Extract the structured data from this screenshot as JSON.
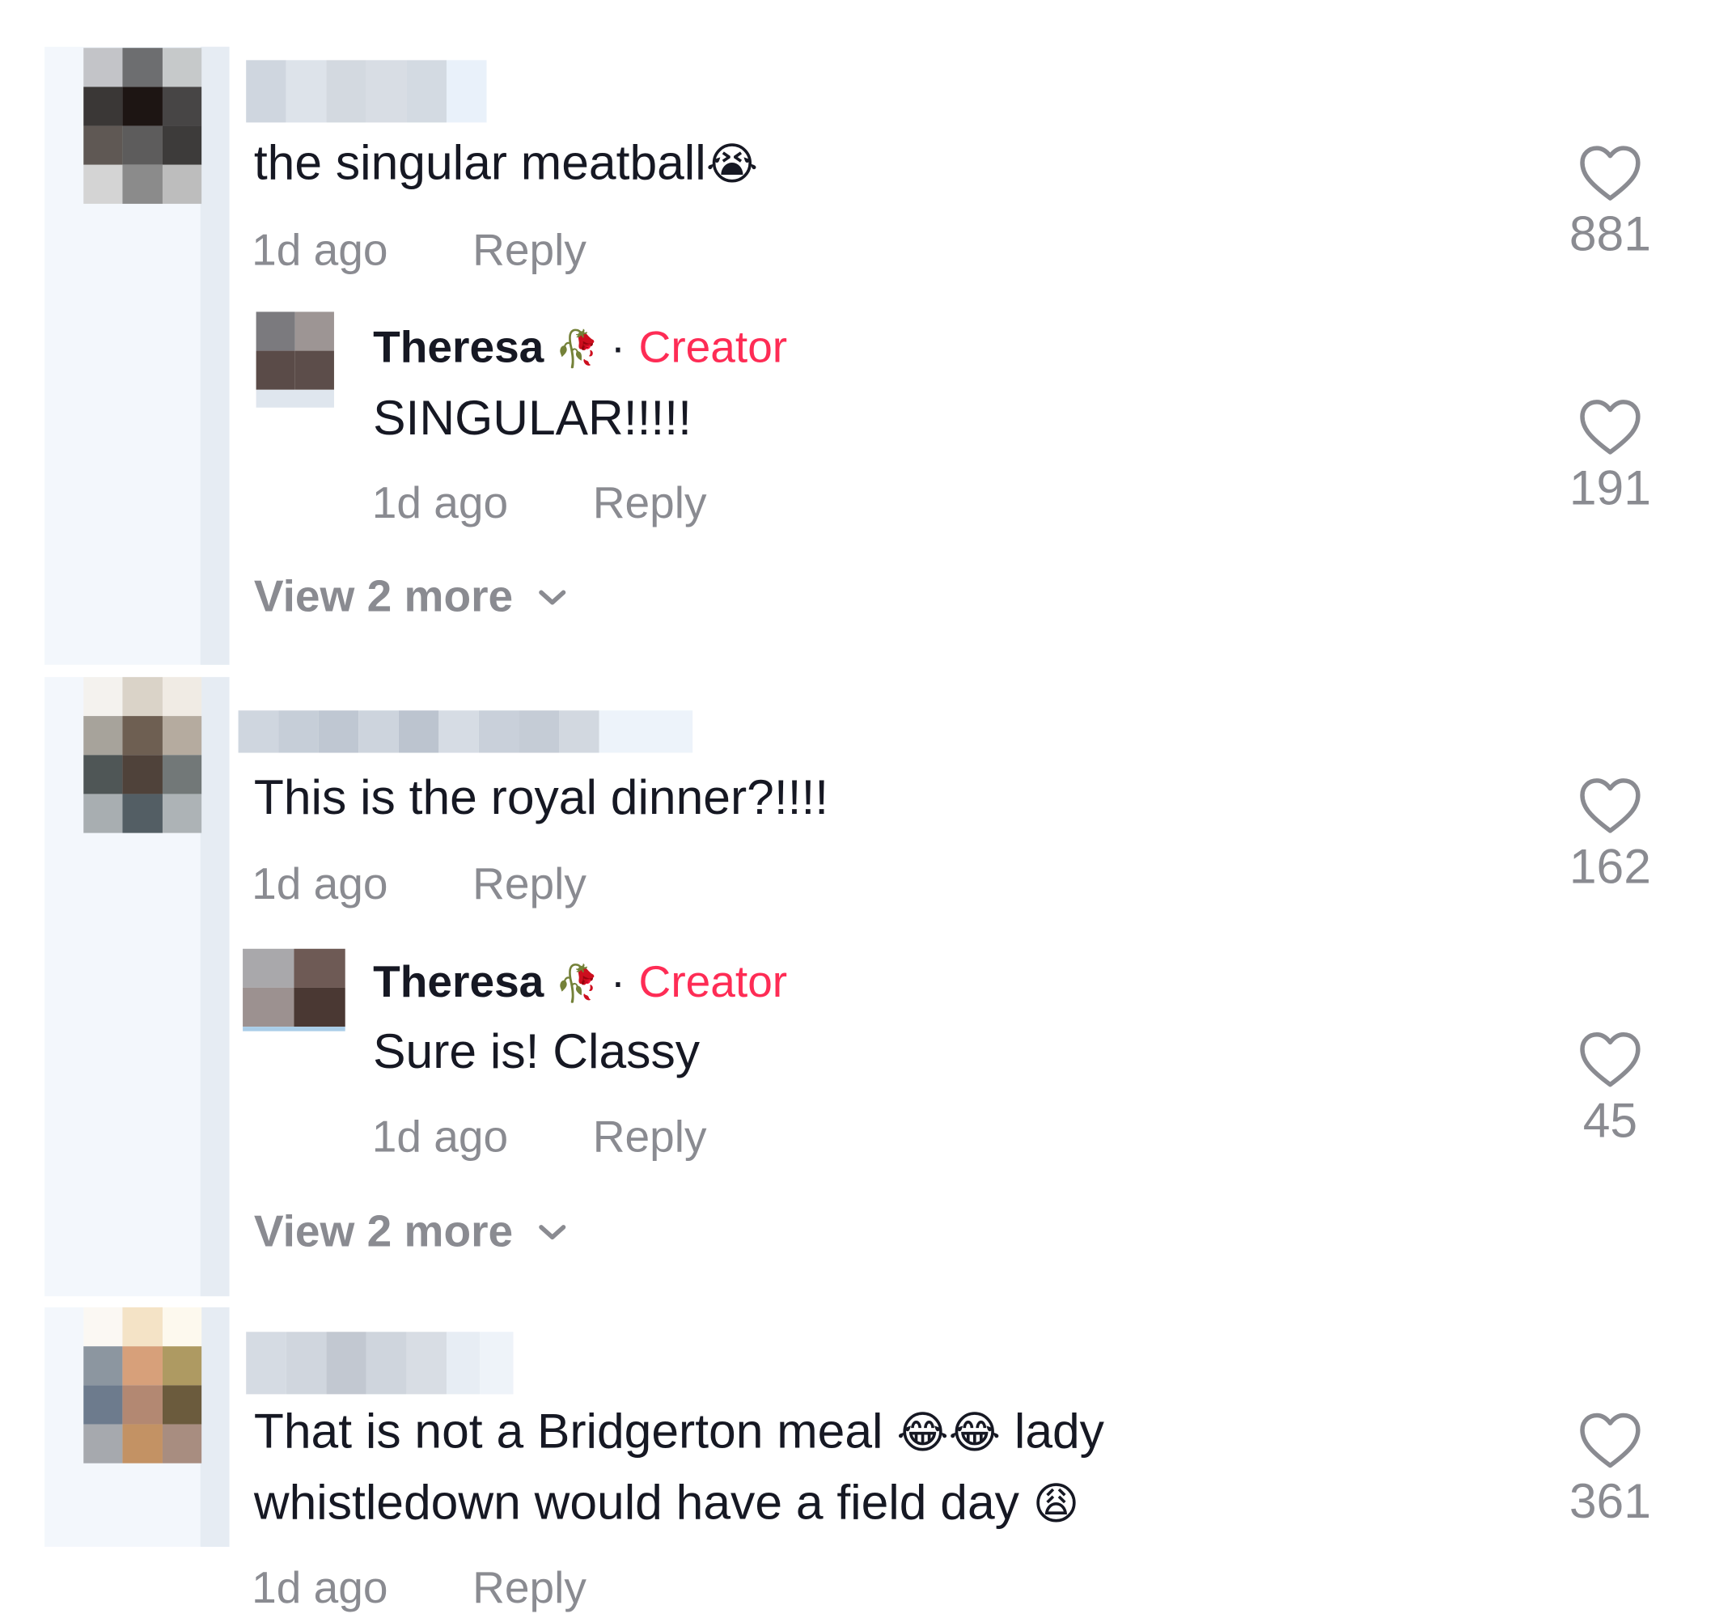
{
  "comments": [
    {
      "text": "the singular meatball",
      "emoji": "😭",
      "time": "1d ago",
      "reply_label": "Reply",
      "likes": "881",
      "reply": {
        "author": "Theresa",
        "author_emoji": "🥀",
        "separator": "·",
        "badge": "Creator",
        "text": "SINGULAR!!!!!",
        "time": "1d ago",
        "reply_label": "Reply",
        "likes": "191"
      },
      "view_more": "View 2 more"
    },
    {
      "text": "This is the royal dinner?!!!!",
      "time": "1d ago",
      "reply_label": "Reply",
      "likes": "162",
      "reply": {
        "author": "Theresa",
        "author_emoji": "🥀",
        "separator": "·",
        "badge": "Creator",
        "text": "Sure is! Classy",
        "time": "1d ago",
        "reply_label": "Reply",
        "likes": "45"
      },
      "view_more": "View 2 more"
    },
    {
      "line1": "That is not a Bridgerton meal",
      "line1_emoji": "😂😂",
      "line1_end": "lady",
      "line2": "whistledown would have a field day",
      "line2_emoji": "😩",
      "time": "1d ago",
      "reply_label": "Reply",
      "likes": "361"
    }
  ],
  "colors": {
    "text": "#161823",
    "muted": "#8a8b91",
    "creator": "#fe2c55"
  }
}
